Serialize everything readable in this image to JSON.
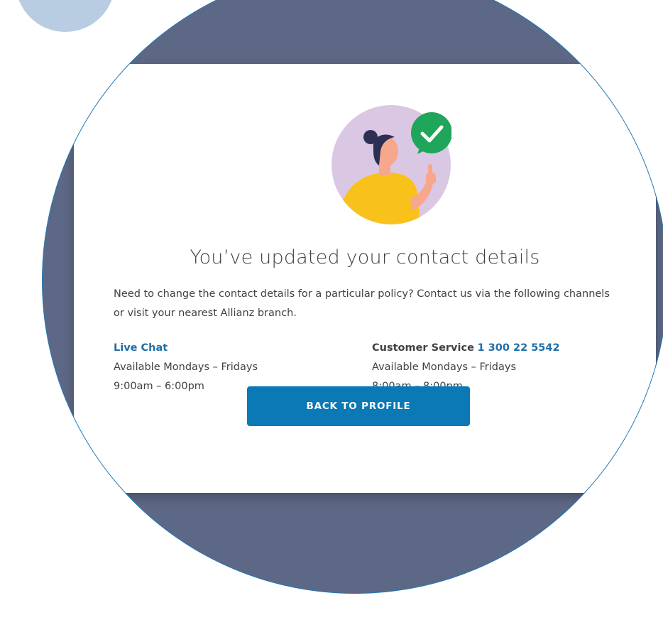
{
  "confirmation": {
    "title": "You’ve updated your contact details",
    "intro": "Need to change the contact details for a particular policy? Contact us via the following channels or visit your nearest Allianz branch."
  },
  "contact": {
    "live_chat": {
      "label": "Live Chat",
      "days": "Available Mondays – Fridays",
      "hours": "9:00am – 6:00pm"
    },
    "customer_service": {
      "label": "Customer Service",
      "phone": "1 300 22 5542",
      "days": "Available Mondays – Fridays",
      "hours": "8:00am – 8:00pm"
    }
  },
  "actions": {
    "back_label": "BACK TO PROFILE"
  },
  "colors": {
    "accent": "#0a79b5",
    "link": "#1f6ea8",
    "backdrop": "#5d6886",
    "success": "#1fa65a",
    "decor": "#b9cde2"
  },
  "icons": {
    "hero": "woman-thumbs-up-illustration",
    "success": "check-badge-icon"
  }
}
